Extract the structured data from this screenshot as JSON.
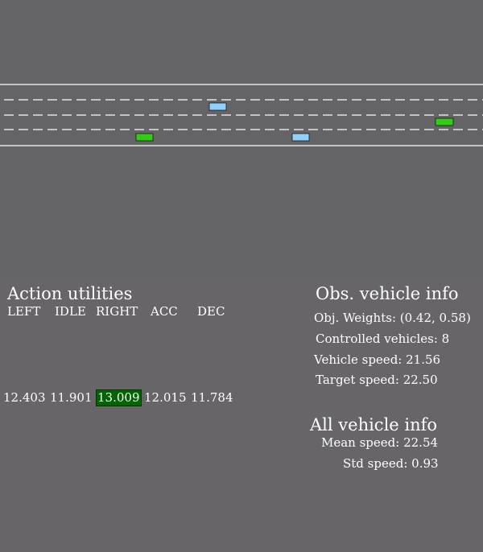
{
  "road": {
    "lanes": 4,
    "vehicles": [
      {
        "kind": "controlled",
        "color": "#8fd0ff",
        "lane": 1
      },
      {
        "kind": "controlled",
        "color": "#8fd0ff",
        "lane": 3
      },
      {
        "kind": "other",
        "color": "#33cc14",
        "lane": 2
      },
      {
        "kind": "other",
        "color": "#33cc14",
        "lane": 3
      }
    ]
  },
  "actions": {
    "title": "Action utilities",
    "labels": [
      "LEFT",
      "IDLE",
      "RIGHT",
      "ACC",
      "DEC"
    ],
    "values": [
      "12.403",
      "11.901",
      "13.009",
      "12.015",
      "11.784"
    ],
    "highlight_color": "#006400",
    "highlight_label": "RIGHT"
  },
  "obs_info": {
    "title": "Obs. vehicle info",
    "obj_weights": "Obj. Weights: (0.42, 0.58)",
    "controlled": "Controlled vehicles: 8",
    "vehicle_speed": "Vehicle speed: 21.56",
    "target_speed": "Target speed: 22.50"
  },
  "all_info": {
    "title": "All vehicle info",
    "mean_speed": "Mean speed: 22.54",
    "std_speed": "Std speed: 0.93"
  }
}
